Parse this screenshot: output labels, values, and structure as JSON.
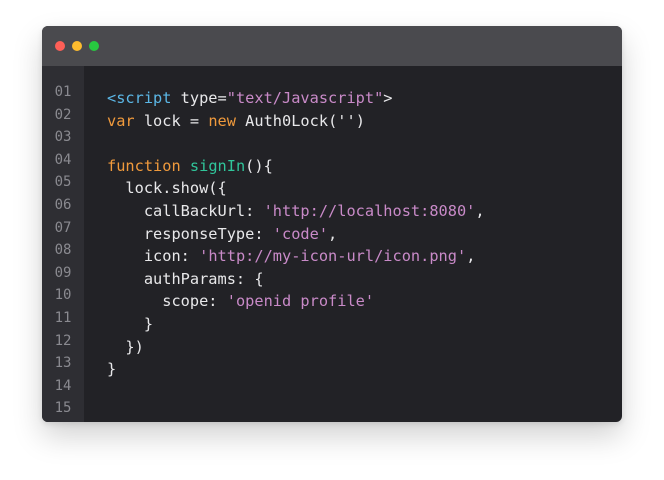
{
  "window": {
    "controls": [
      {
        "name": "close",
        "color": "#fe5f57"
      },
      {
        "name": "minimize",
        "color": "#febc2e"
      },
      {
        "name": "maximize",
        "color": "#28c840"
      }
    ]
  },
  "colors": {
    "background": "#222226",
    "titlebar": "#4a4a4e",
    "gutter": "#2e2e33",
    "tag": "#5bb7e6",
    "keyword": "#f09a3c",
    "function": "#30c59a",
    "string": "#c98ac8",
    "plain": "#e8e8ea"
  },
  "editor": {
    "line_numbers": [
      "01",
      "02",
      "03",
      "04",
      "05",
      "06",
      "07",
      "08",
      "09",
      "10",
      "11",
      "12",
      "13",
      "14",
      "15"
    ],
    "lines": [
      [
        {
          "t": "<script",
          "k": "tag"
        },
        {
          "t": " type=",
          "k": "plain"
        },
        {
          "t": "\"text/Javascript\"",
          "k": "string"
        },
        {
          "t": ">",
          "k": "plain"
        }
      ],
      [
        {
          "t": "var",
          "k": "keyword"
        },
        {
          "t": " lock = ",
          "k": "plain"
        },
        {
          "t": "new",
          "k": "keyword"
        },
        {
          "t": " Auth0Lock('')",
          "k": "plain"
        }
      ],
      [],
      [
        {
          "t": "function",
          "k": "keyword"
        },
        {
          "t": " ",
          "k": "plain"
        },
        {
          "t": "signIn",
          "k": "func"
        },
        {
          "t": "(){",
          "k": "plain"
        }
      ],
      [
        {
          "t": "  lock.show({",
          "k": "plain"
        }
      ],
      [
        {
          "t": "    callBackUrl: ",
          "k": "plain"
        },
        {
          "t": "'http://localhost:8080'",
          "k": "string"
        },
        {
          "t": ",",
          "k": "plain"
        }
      ],
      [
        {
          "t": "    responseType: ",
          "k": "plain"
        },
        {
          "t": "'code'",
          "k": "string"
        },
        {
          "t": ",",
          "k": "plain"
        }
      ],
      [
        {
          "t": "    icon: ",
          "k": "plain"
        },
        {
          "t": "'http://my-icon-url/icon.png'",
          "k": "string"
        },
        {
          "t": ",",
          "k": "plain"
        }
      ],
      [
        {
          "t": "    authParams: {",
          "k": "plain"
        }
      ],
      [
        {
          "t": "      scope: ",
          "k": "plain"
        },
        {
          "t": "'openid profile'",
          "k": "string"
        }
      ],
      [
        {
          "t": "    }",
          "k": "plain"
        }
      ],
      [
        {
          "t": "  })",
          "k": "plain"
        }
      ],
      [
        {
          "t": "}",
          "k": "plain"
        }
      ],
      [],
      []
    ]
  }
}
